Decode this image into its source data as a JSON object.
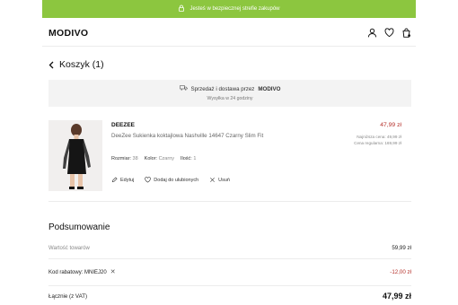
{
  "colors": {
    "accent_green": "#8cc63f",
    "price_red": "#b5312b",
    "panel_grey": "#f3f3f3"
  },
  "secure_bar": {
    "text": "Jesteś w bezpiecznej strefie zakupów",
    "icon": "lock-icon"
  },
  "header": {
    "logo": "MODIVO",
    "icons": [
      "user-icon",
      "heart-icon",
      "bag-icon"
    ]
  },
  "cart": {
    "title": "Koszyk (1)"
  },
  "delivery": {
    "line_prefix": "Sprzedaż i dostawa przez",
    "seller": "MODIVO",
    "shipping": "Wysyłka w 24 godziny",
    "icon": "truck-icon"
  },
  "product": {
    "brand": "DEEZEE",
    "name": "DeeZee Sukienka koktajlowa Nashville 14647 Czarny Slim Fit",
    "size_label": "Rozmiar:",
    "size_value": "38",
    "color_label": "Kolor:",
    "color_value": "Czarny",
    "qty_label": "Ilość:",
    "qty_value": "1",
    "price": "47,99 zł",
    "lowest_price": "Najniższa cena: 49,99 zł",
    "regular_price": "Cena regularna: 169,99 zł",
    "actions": {
      "edit": "Edytuj",
      "favorite": "Dodaj do ulubionych",
      "remove": "Usuń"
    }
  },
  "summary": {
    "title": "Podsumowanie",
    "goods_label": "Wartość towarów",
    "goods_value": "59,99 zł",
    "discount_label": "Kod rabatowy: MNIEJ20",
    "discount_value": "-12,00 zł",
    "total_label": "Łącznie (z VAT)",
    "total_value": "47,99 zł"
  }
}
